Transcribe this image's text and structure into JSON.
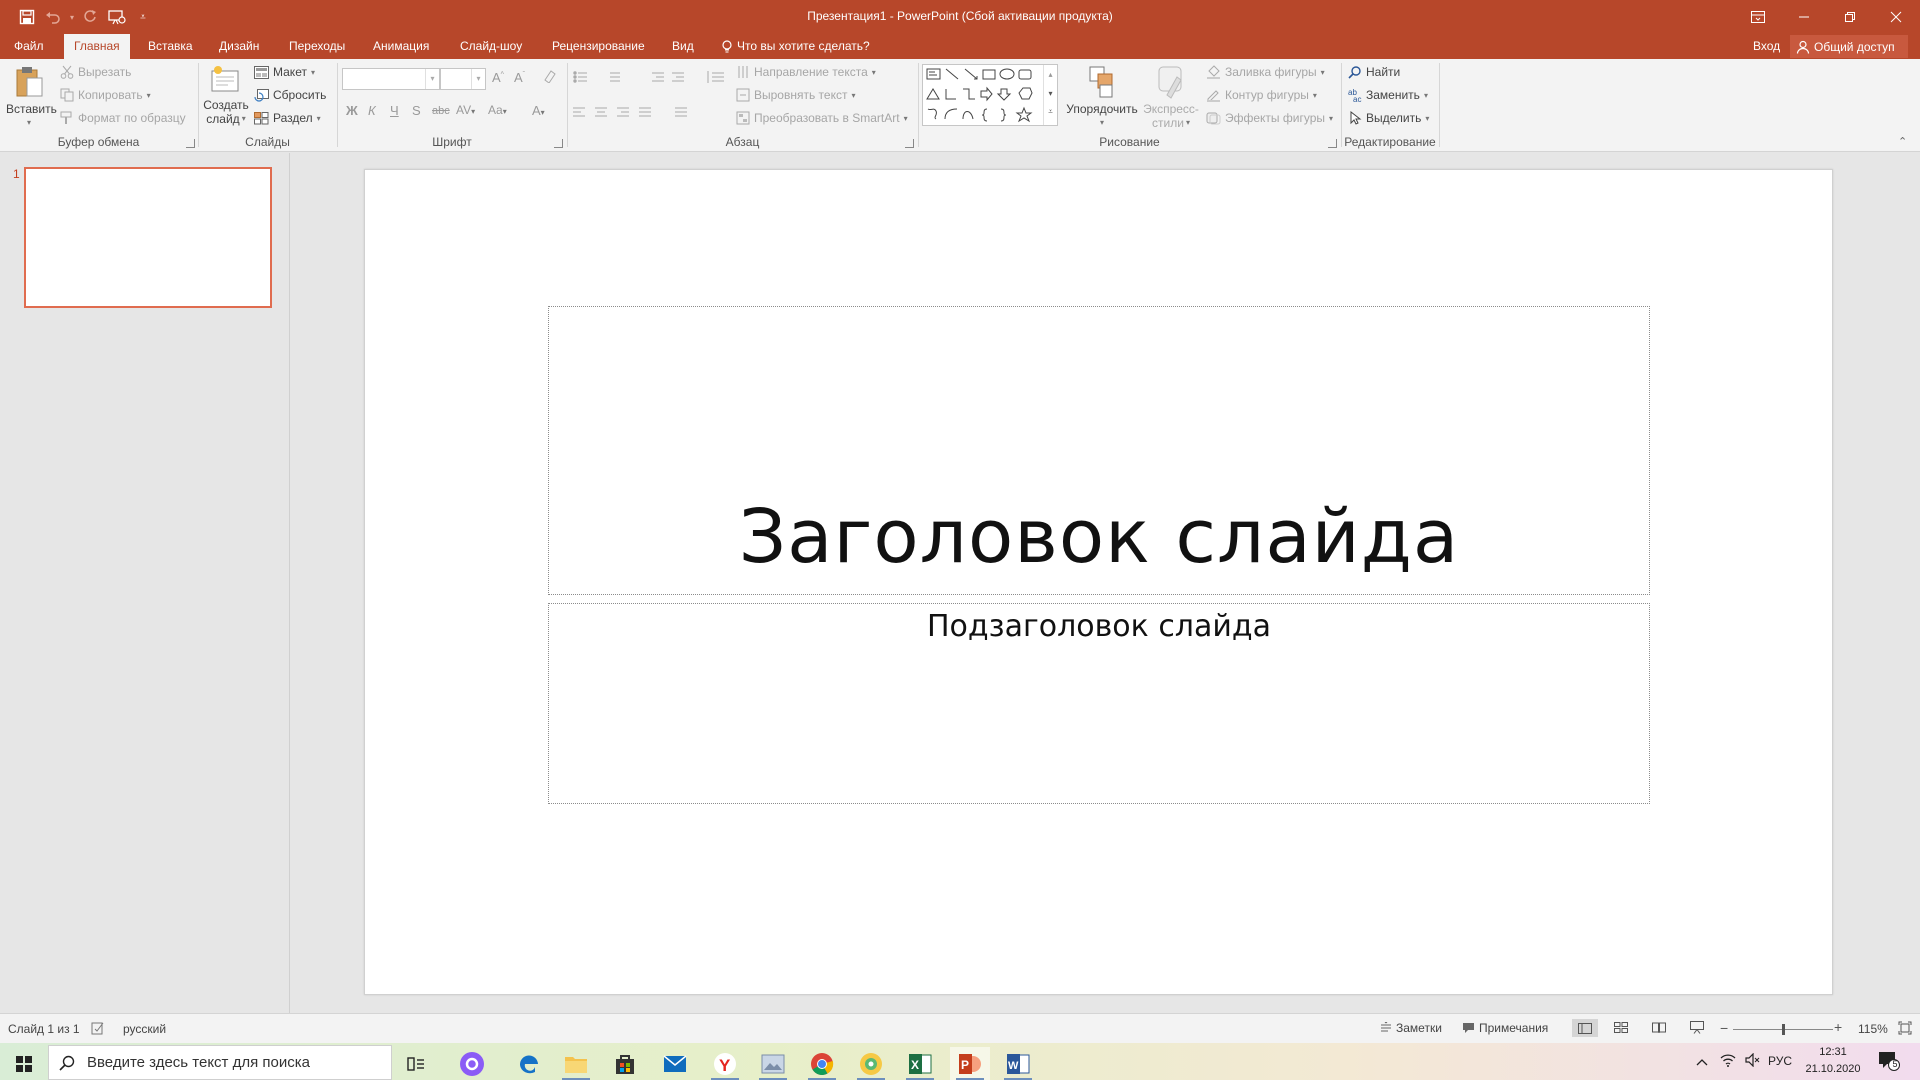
{
  "window": {
    "title": "Презентация1 - PowerPoint (Сбой активации продукта)"
  },
  "tabs": [
    {
      "label": "Файл"
    },
    {
      "label": "Главная"
    },
    {
      "label": "Вставка"
    },
    {
      "label": "Дизайн"
    },
    {
      "label": "Переходы"
    },
    {
      "label": "Анимация"
    },
    {
      "label": "Слайд-шоу"
    },
    {
      "label": "Рецензирование"
    },
    {
      "label": "Вид"
    }
  ],
  "tell_me": "Что вы хотите сделать?",
  "signin": "Вход",
  "share": "Общий доступ",
  "ribbon": {
    "clipboard": {
      "label": "Буфер обмена",
      "paste": "Вставить",
      "cut": "Вырезать",
      "copy": "Копировать",
      "format_painter": "Формат по образцу"
    },
    "slides": {
      "label": "Слайды",
      "new_slide_line1": "Создать",
      "new_slide_line2": "слайд",
      "layout": "Макет",
      "reset": "Сбросить",
      "section": "Раздел"
    },
    "font": {
      "label": "Шрифт",
      "bold": "Ж",
      "italic": "К",
      "underline": "Ч",
      "shadow": "S",
      "strike": "abc",
      "spacing": "AV",
      "case": "Aa",
      "color": "A"
    },
    "paragraph": {
      "label": "Абзац",
      "text_direction": "Направление текста",
      "align_text": "Выровнять текст",
      "smartart": "Преобразовать в SmartArt"
    },
    "drawing": {
      "label": "Рисование",
      "arrange": "Упорядочить",
      "quick_styles_line1": "Экспресс-",
      "quick_styles_line2": "стили",
      "shape_fill": "Заливка фигуры",
      "shape_outline": "Контур фигуры",
      "shape_effects": "Эффекты фигуры"
    },
    "editing": {
      "label": "Редактирование",
      "find": "Найти",
      "replace": "Заменить",
      "select": "Выделить"
    }
  },
  "thumbnails": [
    {
      "number": "1"
    }
  ],
  "slide": {
    "title": "Заголовок слайда",
    "subtitle": "Подзаголовок слайда"
  },
  "status": {
    "slide_counter": "Слайд 1 из 1",
    "language": "русский",
    "notes": "Заметки",
    "comments": "Примечания",
    "zoom": "115%"
  },
  "taskbar": {
    "search_placeholder": "Введите здесь текст для поиска",
    "lang": "РУС",
    "time": "12:31",
    "date": "21.10.2020",
    "notifications": "5"
  },
  "colors": {
    "accent": "#b7472a",
    "selected_thumb_border": "#e06c4f"
  }
}
